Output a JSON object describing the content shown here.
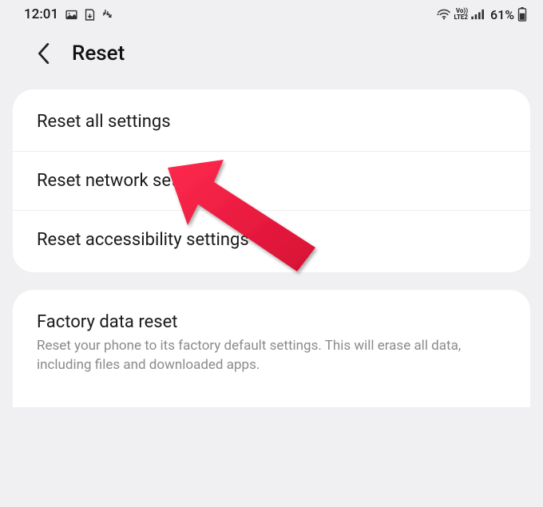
{
  "status_bar": {
    "time": "12:01",
    "network_label": "Vo))\nLTE2",
    "battery_pct": "61%"
  },
  "app_bar": {
    "title": "Reset"
  },
  "sections": [
    {
      "rows": [
        {
          "title": "Reset all settings"
        },
        {
          "title": "Reset network settings"
        },
        {
          "title": "Reset accessibility settings"
        }
      ]
    },
    {
      "rows": [
        {
          "title": "Factory data reset",
          "subtitle": "Reset your phone to its factory default settings. This will erase all data, including files and downloaded apps."
        }
      ]
    }
  ]
}
